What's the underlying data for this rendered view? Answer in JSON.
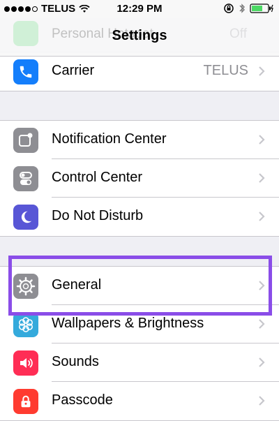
{
  "status_bar": {
    "carrier": "TELUS",
    "time": "12:29 PM"
  },
  "nav": {
    "title": "Settings"
  },
  "ghost_row": {
    "label": "Personal Hotspot",
    "value": "Off"
  },
  "groups": [
    {
      "items": [
        {
          "label": "Carrier",
          "value": "TELUS",
          "icon": "phone-icon",
          "color": "#147efb"
        }
      ]
    },
    {
      "items": [
        {
          "label": "Notification Center",
          "icon": "notification-center-icon",
          "color": "#8e8e93"
        },
        {
          "label": "Control Center",
          "icon": "control-center-icon",
          "color": "#8e8e93"
        },
        {
          "label": "Do Not Disturb",
          "icon": "moon-icon",
          "color": "#5856d6"
        }
      ]
    },
    {
      "items": [
        {
          "label": "General",
          "icon": "gear-icon",
          "color": "#8e8e93"
        },
        {
          "label": "Wallpapers & Brightness",
          "icon": "flower-icon",
          "color": "#34aadc"
        },
        {
          "label": "Sounds",
          "icon": "speaker-icon",
          "color": "#ff2d55"
        },
        {
          "label": "Passcode",
          "icon": "lock-icon",
          "color": "#ff3b30"
        }
      ]
    }
  ],
  "highlight_color": "#8a4de8"
}
